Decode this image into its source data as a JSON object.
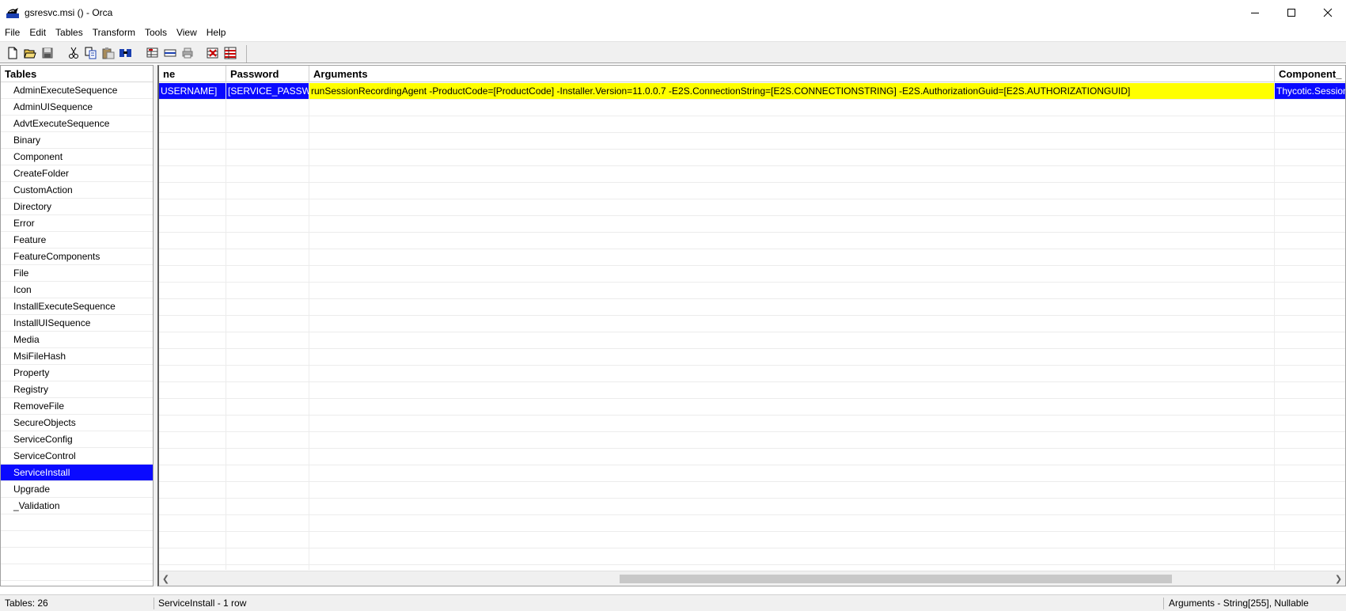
{
  "window": {
    "title": "gsresvc.msi () - Orca"
  },
  "menu": [
    "File",
    "Edit",
    "Tables",
    "Transform",
    "Tools",
    "View",
    "Help"
  ],
  "toolbar": {
    "group1": [
      "new-icon",
      "open-icon",
      "save-icon"
    ],
    "group2": [
      "cut-icon",
      "copy-icon",
      "paste-icon",
      "find-icon"
    ],
    "group3": [
      "add-row-icon",
      "drop-table-icon",
      "print-icon"
    ],
    "group4": [
      "validate-icon",
      "table-icon"
    ]
  },
  "tables_pane": {
    "header": "Tables",
    "items": [
      "AdminExecuteSequence",
      "AdminUISequence",
      "AdvtExecuteSequence",
      "Binary",
      "Component",
      "CreateFolder",
      "CustomAction",
      "Directory",
      "Error",
      "Feature",
      "FeatureComponents",
      "File",
      "Icon",
      "InstallExecuteSequence",
      "InstallUISequence",
      "Media",
      "MsiFileHash",
      "Property",
      "Registry",
      "RemoveFile",
      "SecureObjects",
      "ServiceConfig",
      "ServiceControl",
      "ServiceInstall",
      "Upgrade",
      "_Validation"
    ],
    "selected": "ServiceInstall"
  },
  "grid": {
    "columns": [
      "ne",
      "Password",
      "Arguments",
      "Component_"
    ],
    "row": {
      "name": "USERNAME]",
      "password": "[SERVICE_PASSW...",
      "arguments": "runSessionRecordingAgent -ProductCode=[ProductCode] -Installer.Version=11.0.0.7 -E2S.ConnectionString=[E2S.CONNECTIONSTRING] -E2S.AuthorizationGuid=[E2S.AUTHORIZATIONGUID]",
      "component": "Thycotic.Session"
    },
    "colors": {
      "highlight": "#ffff00",
      "selection": "#0a0aff"
    }
  },
  "status": {
    "tables_count": "Tables: 26",
    "current_table": "ServiceInstall - 1 row",
    "column_info": "Arguments - String[255], Nullable"
  }
}
